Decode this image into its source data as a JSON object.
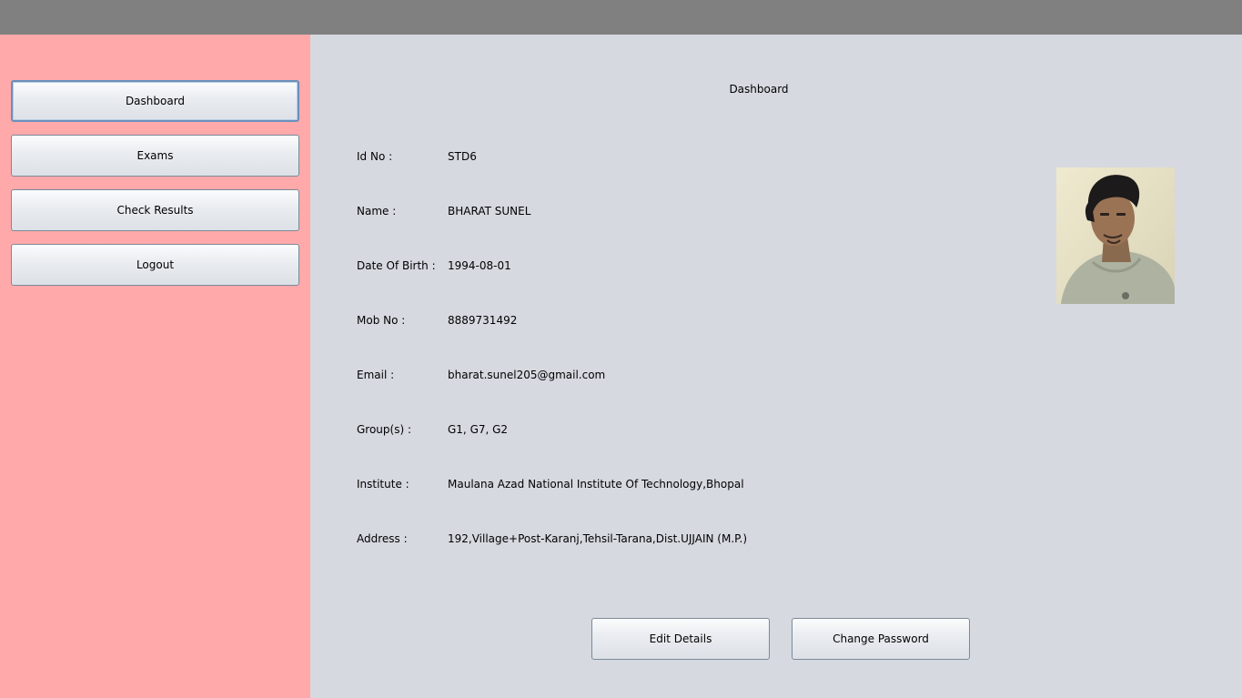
{
  "sidebar": {
    "items": [
      {
        "label": "Dashboard",
        "active": true
      },
      {
        "label": "Exams",
        "active": false
      },
      {
        "label": "Check Results",
        "active": false
      },
      {
        "label": "Logout",
        "active": false
      }
    ]
  },
  "main": {
    "title": "Dashboard",
    "fields": [
      {
        "label": "Id No :",
        "value": "STD6"
      },
      {
        "label": "Name :",
        "value": "BHARAT SUNEL"
      },
      {
        "label": "Date Of Birth :",
        "value": "1994-08-01"
      },
      {
        "label": "Mob No :",
        "value": "8889731492"
      },
      {
        "label": "Email :",
        "value": "bharat.sunel205@gmail.com"
      },
      {
        "label": "Group(s) :",
        "value": "G1, G7, G2"
      },
      {
        "label": "Institute :",
        "value": "Maulana Azad National Institute Of Technology,Bhopal"
      },
      {
        "label": "Address :",
        "value": "192,Village+Post-Karanj,Tehsil-Tarana,Dist.UJJAIN (M.P.)"
      }
    ],
    "actions": {
      "edit_label": "Edit Details",
      "change_password_label": "Change Password"
    }
  },
  "colors": {
    "titlebar": "#808080",
    "sidebar": "#ffa9aa",
    "main_background": "#d6d9e0",
    "active_border": "#6a90bb"
  }
}
